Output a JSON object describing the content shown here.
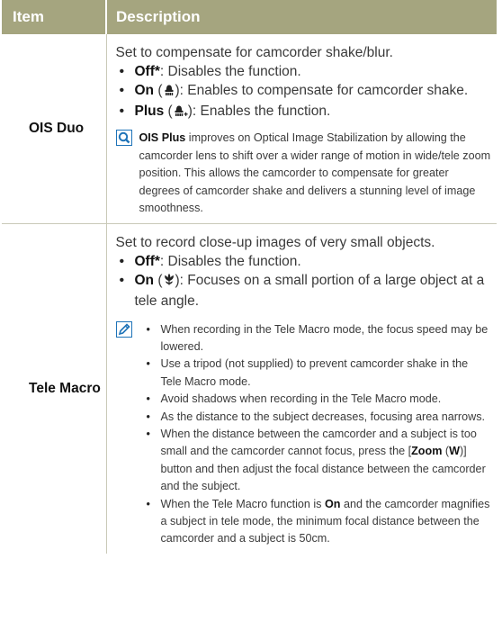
{
  "header": {
    "item": "Item",
    "description": "Description"
  },
  "rows": [
    {
      "item": "OIS Duo",
      "lead": "Set to compensate for camcorder shake/blur.",
      "bullets": [
        {
          "key": "Off*",
          "paren": "",
          "text": ": Disables the function."
        },
        {
          "key": "On",
          "paren": " (",
          "icon": "ois-on-icon",
          "paren_close": ")",
          "text": ": Enables to compensate for camcorder shake."
        },
        {
          "key": "Plus",
          "paren": " (",
          "icon": "ois-plus-icon",
          "paren_close": ")",
          "text": ": Enables the function."
        }
      ],
      "note_icon": "magnifier-icon",
      "note_bold": "OIS Plus",
      "note_text": " improves on Optical Image Stabilization by allowing the camcorder lens to shift over a wider range of motion in wide/tele zoom position. This allows the camcorder to compensate for greater degrees of camcorder shake and delivers a stunning level of image smoothness."
    },
    {
      "item": "Tele Macro",
      "lead": "Set to record close-up images of very small objects.",
      "bullets": [
        {
          "key": "Off*",
          "text": ": Disables the function."
        },
        {
          "key": "On",
          "paren": " (",
          "icon": "tulip-macro-icon",
          "paren_close": ")",
          "text": ": Focuses on a small portion of a large object at a tele angle."
        }
      ],
      "note_icon": "pencil-note-icon",
      "notes": [
        "When recording in the Tele Macro mode, the focus speed may be lowered.",
        "Use a tripod (not supplied) to prevent camcorder shake in the Tele Macro mode.",
        "Avoid shadows when recording in the Tele Macro mode.",
        "As the distance to the subject decreases, focusing area narrows.",
        {
          "pre": "When the distance between the camcorder and a subject is too small and the camcorder cannot focus, press the [",
          "b1": "Zoom",
          "mid": " (",
          "b2": "W",
          "post": ")] button and then adjust the focal distance between the camcorder and the subject."
        },
        {
          "pre": "When the Tele Macro function is ",
          "b1": "On",
          "post": " and the camcorder magnifies a subject in tele mode, the minimum focal distance between the camcorder and a subject is 50cm."
        }
      ]
    }
  ],
  "colors": {
    "header_bg": "#a5a57f",
    "accent_blue": "#1e73b8",
    "rule": "#c9c9b8"
  }
}
